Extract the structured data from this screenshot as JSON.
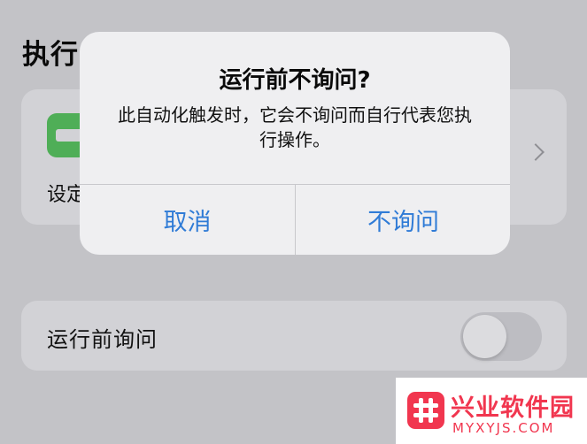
{
  "background": {
    "section_title": "执行",
    "shortcut_label": "设定",
    "ask_before_running_label": "运行前询问",
    "ask_before_running_enabled": false
  },
  "alert": {
    "title": "运行前不询问?",
    "message": "此自动化触发时，它会不询问而自行代表您执行操作。",
    "cancel_label": "取消",
    "confirm_label": "不询问",
    "accent_color": "#2f7bd6"
  },
  "watermark": {
    "name": "兴业软件园",
    "url": "MYXYJS.COM",
    "brand_color": "#f1364f"
  },
  "icons": {
    "shortcut": "green-shortcut-tile-icon",
    "chevron": "chevron-right-icon",
    "logo": "hash-logo-icon"
  }
}
